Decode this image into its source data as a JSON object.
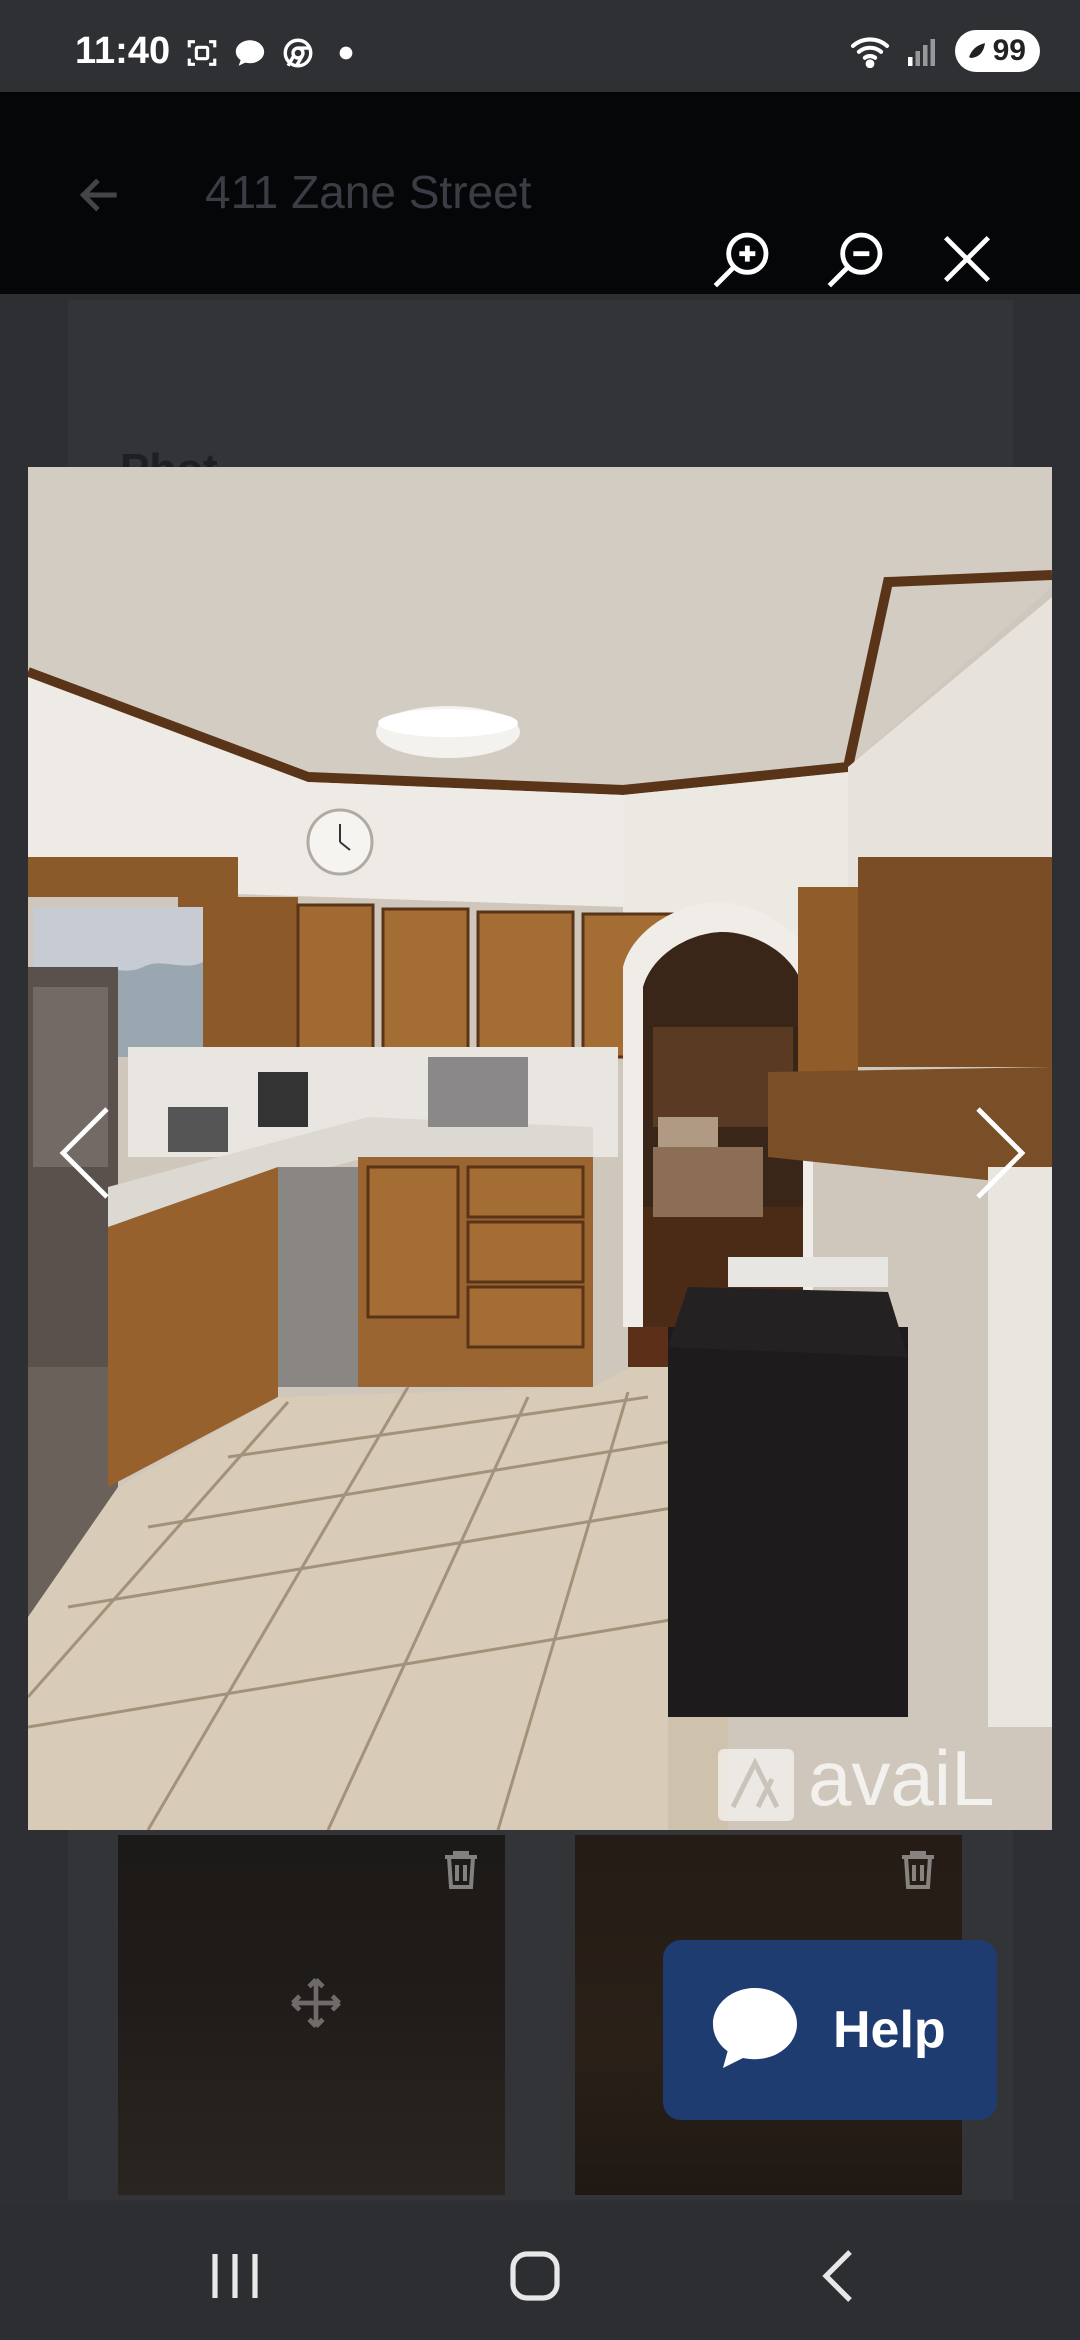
{
  "status_bar": {
    "time": "11:40",
    "battery": "99",
    "icons": [
      "screenshot-icon",
      "chat-icon",
      "chrome-icon",
      "dot-icon",
      "wifi-icon",
      "signal-icon",
      "battery-icon"
    ]
  },
  "page": {
    "title": "411 Zane Street",
    "section_title": "Phot"
  },
  "viewer": {
    "zoom_in": "zoom-in-icon",
    "zoom_out": "zoom-out-icon",
    "close": "close-icon",
    "prev": "chevron-left-icon",
    "next": "chevron-right-icon",
    "watermark": "avaiL"
  },
  "help": {
    "label": "Help"
  },
  "nav_bar": {
    "icons": [
      "recent-apps-icon",
      "home-icon",
      "back-icon"
    ]
  },
  "colors": {
    "help_bg": "#1f3c71",
    "header_bg": "#050608",
    "page_bg": "#2e2f32"
  }
}
